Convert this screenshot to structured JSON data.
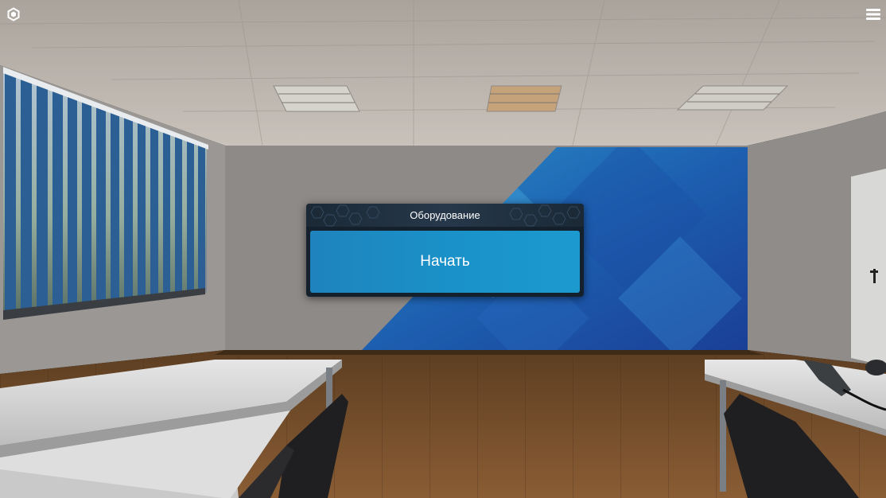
{
  "app": {
    "logo_icon": "logo-icon",
    "menu_icon": "hamburger-menu-icon"
  },
  "dialog": {
    "title": "Оборудование",
    "start_label": "Начать"
  },
  "colors": {
    "accent": "#1a92c9",
    "dialog_bg": "#14202b",
    "text": "#ffffff"
  }
}
